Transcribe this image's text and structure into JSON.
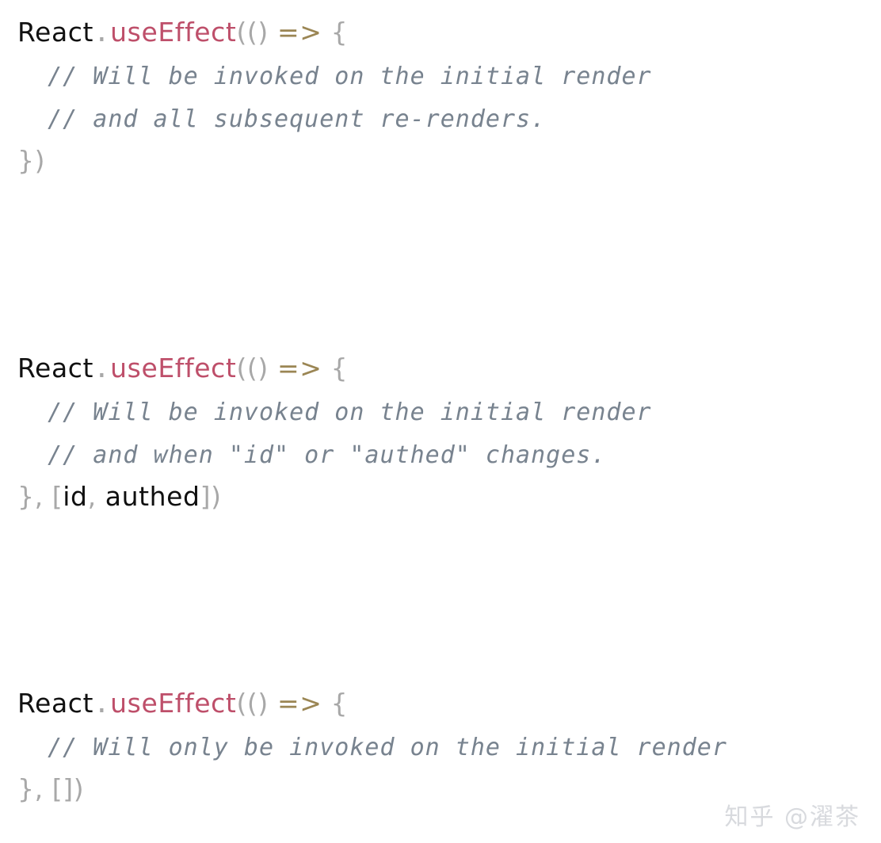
{
  "page": {
    "background_color": "#ffffff",
    "kind": "code-snippet-image"
  },
  "theme": {
    "plain_color": "#111111",
    "identifier_color": "#101010",
    "property_color": "#be4f6a",
    "punctuation_color": "#a8a8a8",
    "arrow_color": "#9b8654",
    "comment_color": "#78838f",
    "watermark_color": "#d8dade"
  },
  "blocks": [
    {
      "id": "block-0",
      "title": "useEffect without dependency array",
      "lines": [
        {
          "id": "b0l0",
          "text": "React.useEffect(() => {",
          "tokens": [
            {
              "t": "React",
              "k": "plain"
            },
            {
              "t": ".",
              "k": "dot"
            },
            {
              "t": "useEffect",
              "k": "prop"
            },
            {
              "t": "(()",
              "k": "punct"
            },
            {
              "t": " ",
              "k": "punct"
            },
            {
              "t": "=>",
              "k": "arrow"
            },
            {
              "t": " {",
              "k": "punct"
            }
          ]
        },
        {
          "id": "b0l1",
          "text": "  // Will be invoked on the initial render",
          "tokens": [
            {
              "t": "  // Will be invoked on the initial render",
              "k": "comment"
            }
          ]
        },
        {
          "id": "b0l2",
          "text": "  // and all subsequent re-renders.",
          "tokens": [
            {
              "t": "  // and all subsequent re-renders.",
              "k": "comment"
            }
          ]
        },
        {
          "id": "b0l3",
          "text": "})",
          "tokens": [
            {
              "t": "})",
              "k": "punct"
            }
          ]
        }
      ]
    },
    {
      "id": "block-1",
      "title": "useEffect with dependency array [id, authed]",
      "lines": [
        {
          "id": "b1l0",
          "text": "React.useEffect(() => {",
          "tokens": [
            {
              "t": "React",
              "k": "plain"
            },
            {
              "t": ".",
              "k": "dot"
            },
            {
              "t": "useEffect",
              "k": "prop"
            },
            {
              "t": "(()",
              "k": "punct"
            },
            {
              "t": " ",
              "k": "punct"
            },
            {
              "t": "=>",
              "k": "arrow"
            },
            {
              "t": " {",
              "k": "punct"
            }
          ]
        },
        {
          "id": "b1l1",
          "text": "  // Will be invoked on the initial render",
          "tokens": [
            {
              "t": "  // Will be invoked on the initial render",
              "k": "comment"
            }
          ]
        },
        {
          "id": "b1l2",
          "text": "  // and when \"id\" or \"authed\" changes.",
          "tokens": [
            {
              "t": "  // and when \"id\" or \"authed\" changes.",
              "k": "comment"
            }
          ]
        },
        {
          "id": "b1l3",
          "text": "}, [id, authed])",
          "tokens": [
            {
              "t": "}, [",
              "k": "punct"
            },
            {
              "t": "id",
              "k": "ident"
            },
            {
              "t": ", ",
              "k": "punct"
            },
            {
              "t": "authed",
              "k": "ident"
            },
            {
              "t": "])",
              "k": "punct"
            }
          ]
        }
      ]
    },
    {
      "id": "block-2",
      "title": "useEffect with empty dependency array",
      "lines": [
        {
          "id": "b2l0",
          "text": "React.useEffect(() => {",
          "tokens": [
            {
              "t": "React",
              "k": "plain"
            },
            {
              "t": ".",
              "k": "dot"
            },
            {
              "t": "useEffect",
              "k": "prop"
            },
            {
              "t": "(()",
              "k": "punct"
            },
            {
              "t": " ",
              "k": "punct"
            },
            {
              "t": "=>",
              "k": "arrow"
            },
            {
              "t": " {",
              "k": "punct"
            }
          ]
        },
        {
          "id": "b2l1",
          "text": "  // Will only be invoked on the initial render",
          "tokens": [
            {
              "t": "  // Will only be invoked on the initial render",
              "k": "comment"
            }
          ]
        },
        {
          "id": "b2l2",
          "text": "}, [])",
          "tokens": [
            {
              "t": "}, [])",
              "k": "punct"
            }
          ]
        }
      ]
    }
  ],
  "watermark": {
    "text": "知乎 @濯茶"
  }
}
